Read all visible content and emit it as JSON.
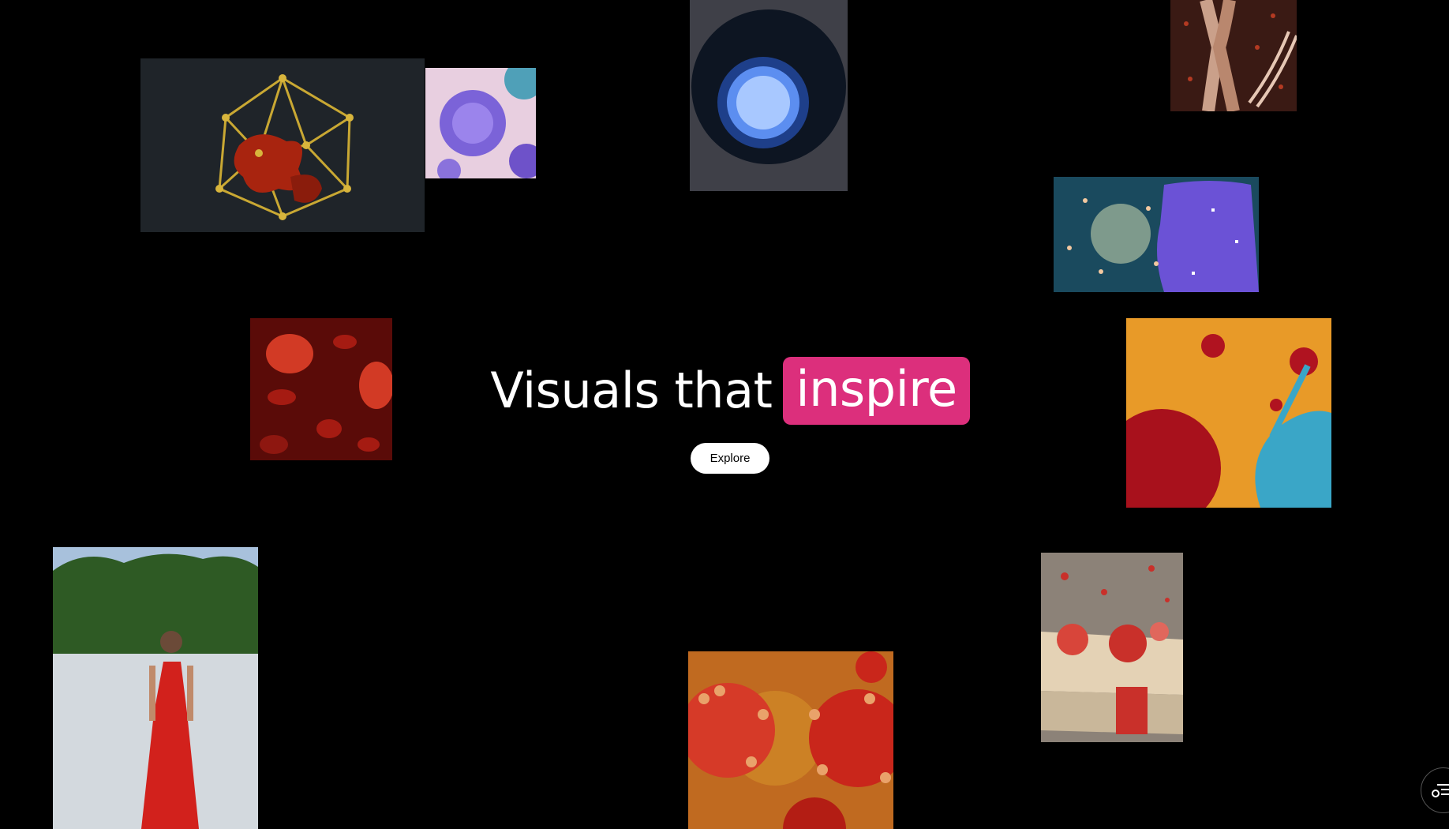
{
  "hero": {
    "headline_prefix": "Visuals that",
    "headline_highlight": "inspire",
    "explore_label": "Explore"
  },
  "colors": {
    "background": "#000000",
    "highlight": "#dc2f7c",
    "button_bg": "#ffffff"
  },
  "gallery": {
    "tiles": [
      {
        "name": "icosahedron-cage-image"
      },
      {
        "name": "purple-pollen-image"
      },
      {
        "name": "glowing-sphere-image"
      },
      {
        "name": "chromosome-dna-image"
      },
      {
        "name": "immune-cell-image"
      },
      {
        "name": "blood-cells-image"
      },
      {
        "name": "orange-membrane-cells-image"
      },
      {
        "name": "beach-portrait-image"
      },
      {
        "name": "cell-membrane-proteins-image"
      },
      {
        "name": "virus-particles-image"
      }
    ]
  },
  "fab": {
    "icon": "menu-filter-icon"
  }
}
